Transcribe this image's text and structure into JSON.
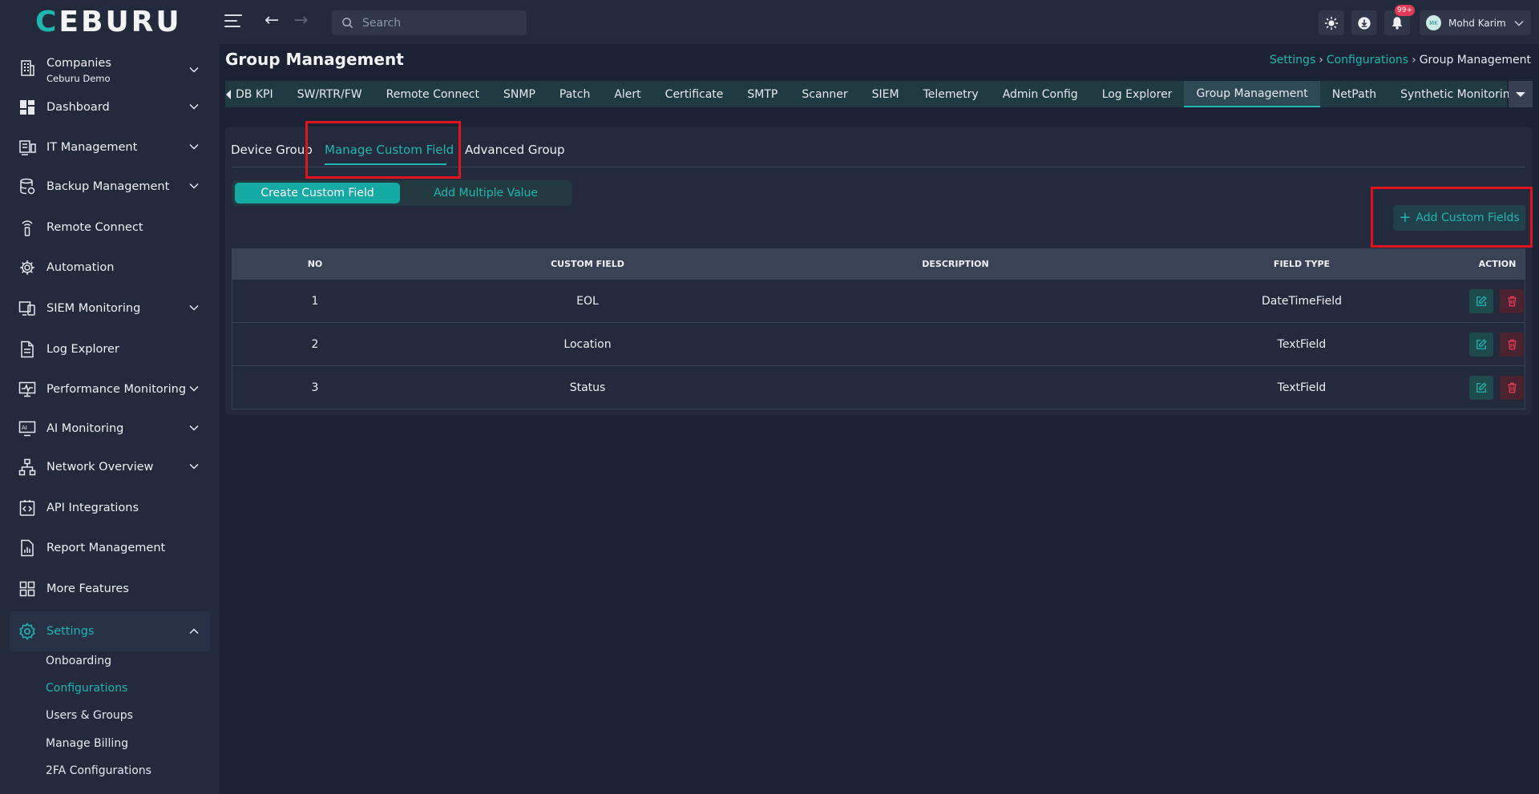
{
  "app": {
    "logo_first": "C",
    "logo_rest": "EBURU"
  },
  "topbar": {
    "search_placeholder": "Search",
    "notification_count": "99+",
    "user_initials": "MK",
    "user_name": "Mohd Karim"
  },
  "sidebar": {
    "company_label": "Companies",
    "company_value": "Ceburu Demo",
    "items": [
      {
        "label": "Dashboard"
      },
      {
        "label": "IT Management"
      },
      {
        "label": "Backup Management"
      },
      {
        "label": "Remote Connect"
      },
      {
        "label": "Automation"
      },
      {
        "label": "SIEM Monitoring"
      },
      {
        "label": "Log Explorer"
      },
      {
        "label": "Performance Monitoring"
      },
      {
        "label": "AI Monitoring"
      },
      {
        "label": "Network Overview"
      },
      {
        "label": "API Integrations"
      },
      {
        "label": "Report Management"
      },
      {
        "label": "More Features"
      },
      {
        "label": "Settings"
      }
    ],
    "settings_sub": [
      {
        "label": "Onboarding"
      },
      {
        "label": "Configurations"
      },
      {
        "label": "Users & Groups"
      },
      {
        "label": "Manage Billing"
      },
      {
        "label": "2FA Configurations"
      }
    ]
  },
  "page": {
    "title": "Group Management",
    "breadcrumb": [
      "Settings",
      "Configurations",
      "Group Management"
    ]
  },
  "tabs": [
    "DB KPI",
    "SW/RTR/FW",
    "Remote Connect",
    "SNMP",
    "Patch",
    "Alert",
    "Certificate",
    "SMTP",
    "Scanner",
    "SIEM",
    "Telemetry",
    "Admin Config",
    "Log Explorer",
    "Group Management",
    "NetPath",
    "Synthetic Monitoring"
  ],
  "active_tab": "Group Management",
  "subtabs": [
    "Device Group",
    "Manage Custom Field",
    "Advanced Group"
  ],
  "segment": {
    "on": "Create Custom Field",
    "off": "Add Multiple Value"
  },
  "add_button": "Add Custom Fields",
  "table": {
    "headers": [
      "NO",
      "CUSTOM FIELD",
      "DESCRIPTION",
      "FIELD TYPE",
      "ACTION"
    ],
    "rows": [
      {
        "no": "1",
        "field": "EOL",
        "description": "",
        "type": "DateTimeField"
      },
      {
        "no": "2",
        "field": "Location",
        "description": "",
        "type": "TextField"
      },
      {
        "no": "3",
        "field": "Status",
        "description": "",
        "type": "TextField"
      }
    ]
  },
  "colors": {
    "accent": "#1fb6b0",
    "highlight": "#e0131f",
    "danger": "#e33b55"
  }
}
